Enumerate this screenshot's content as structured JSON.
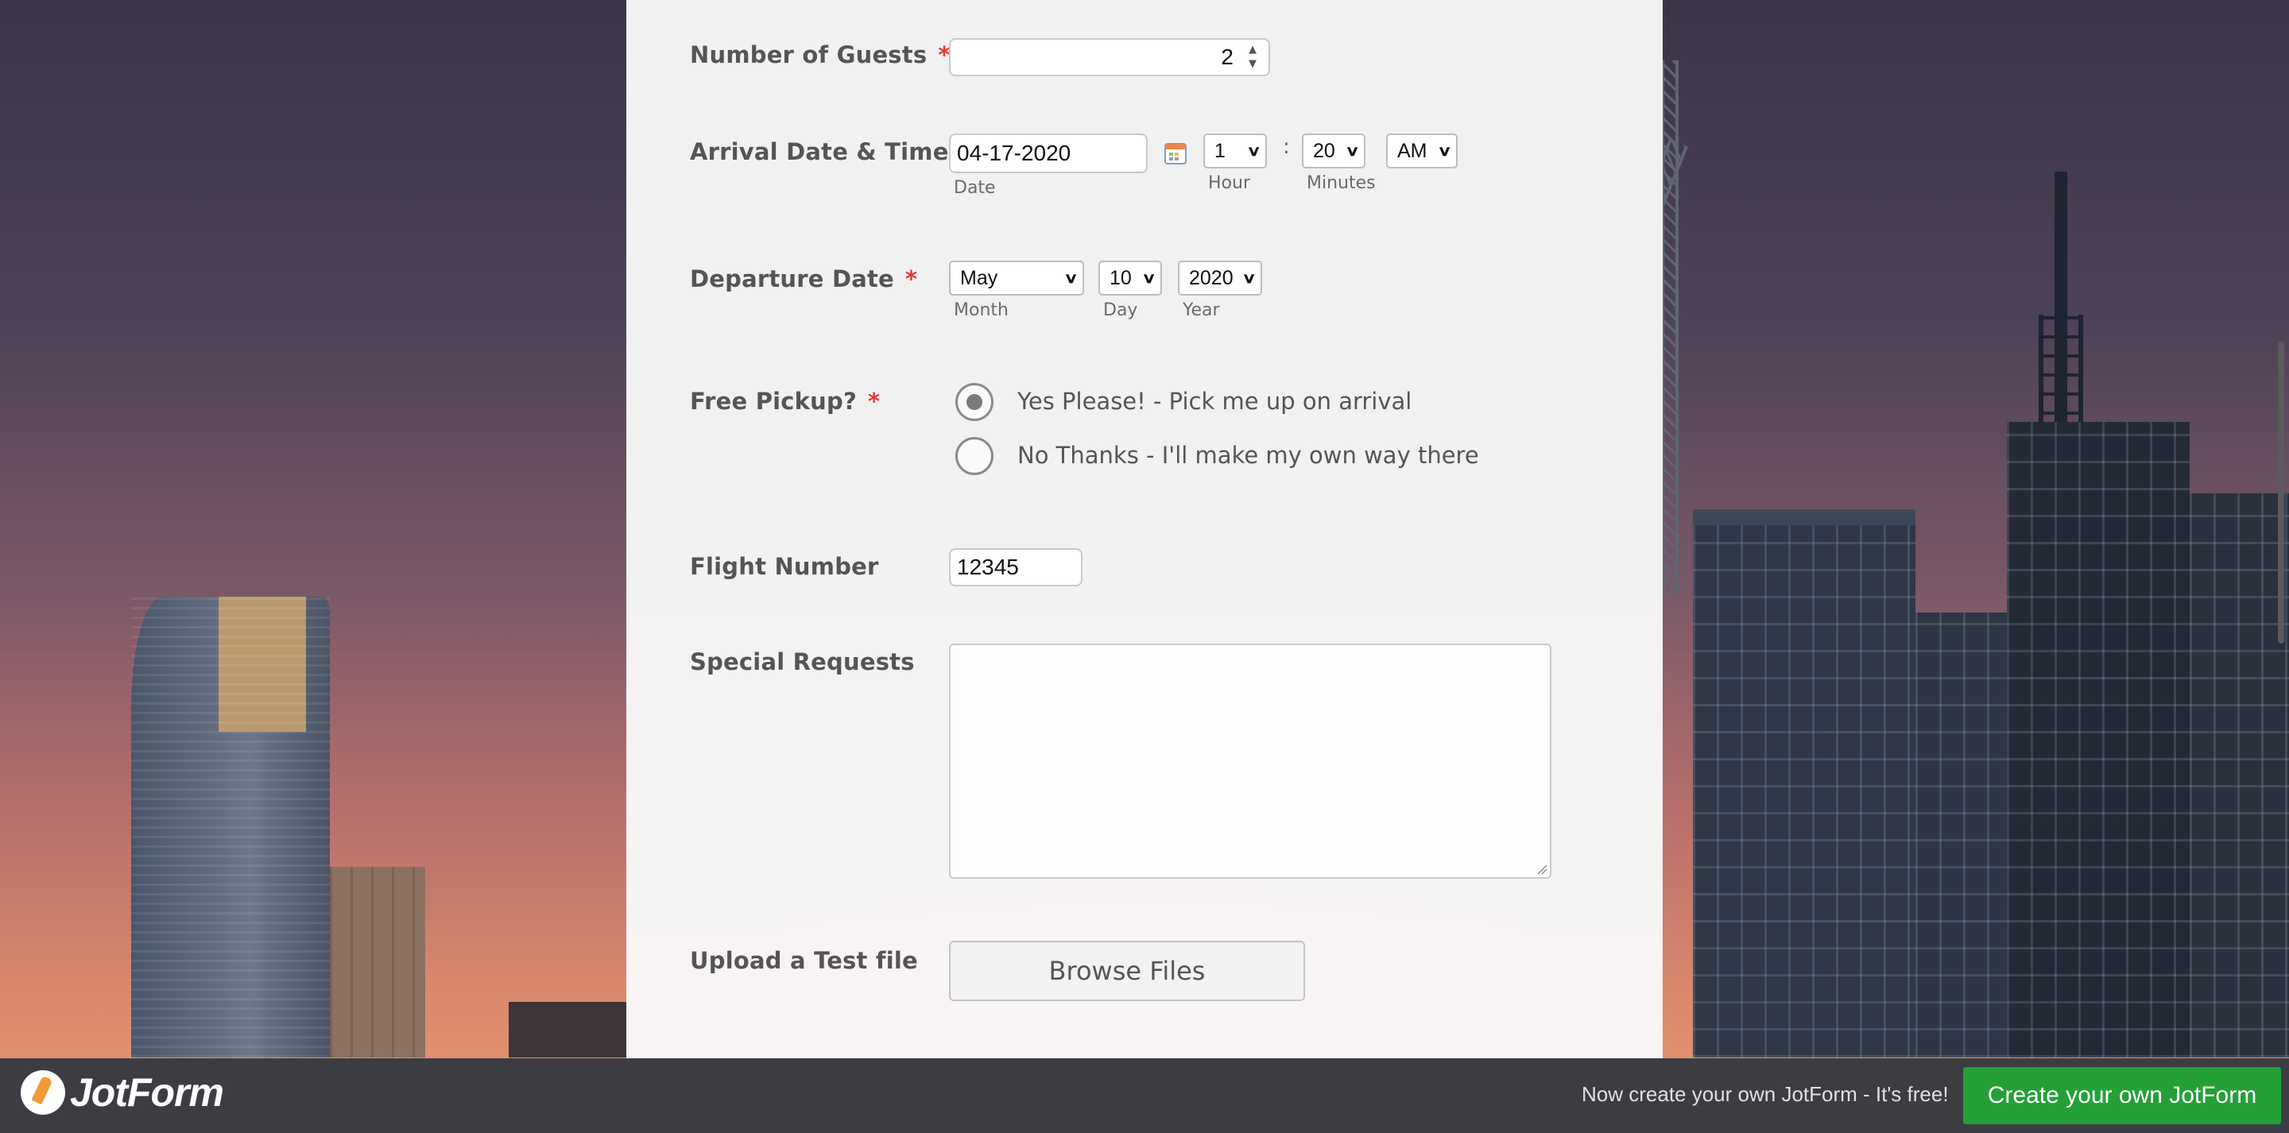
{
  "colors": {
    "required": "#e53935",
    "cta": "#24a036",
    "footer": "#3b3d42"
  },
  "form": {
    "guests": {
      "label": "Number of Guests",
      "required": "*",
      "value": "2",
      "spinner_up": "▲",
      "spinner_down": "▼"
    },
    "arrival": {
      "label": "Arrival Date & Time",
      "required": "*",
      "date_value": "04-17-2020",
      "date_sublabel": "Date",
      "calendar_icon": "calendar-icon",
      "hour_value": "1",
      "hour_sublabel": "Hour",
      "separator": ":",
      "minute_value": "20",
      "minute_sublabel": "Minutes",
      "ampm_value": "AM"
    },
    "departure": {
      "label": "Departure Date",
      "required": "*",
      "month_value": "May",
      "month_sublabel": "Month",
      "day_value": "10",
      "day_sublabel": "Day",
      "year_value": "2020",
      "year_sublabel": "Year"
    },
    "pickup": {
      "label": "Free Pickup?",
      "required": "*",
      "options": [
        {
          "label": "Yes Please! - Pick me up on arrival",
          "checked": true
        },
        {
          "label": "No Thanks - I'll make my own way there",
          "checked": false
        }
      ]
    },
    "flight": {
      "label": "Flight Number",
      "value": "12345"
    },
    "requests": {
      "label": "Special Requests",
      "value": ""
    },
    "upload": {
      "label": "Upload a Test file",
      "button_label": "Browse Files"
    }
  },
  "footer": {
    "logo_text": "JotForm",
    "note": "Now create your own JotForm - It's free!",
    "cta_label": "Create your own JotForm"
  }
}
